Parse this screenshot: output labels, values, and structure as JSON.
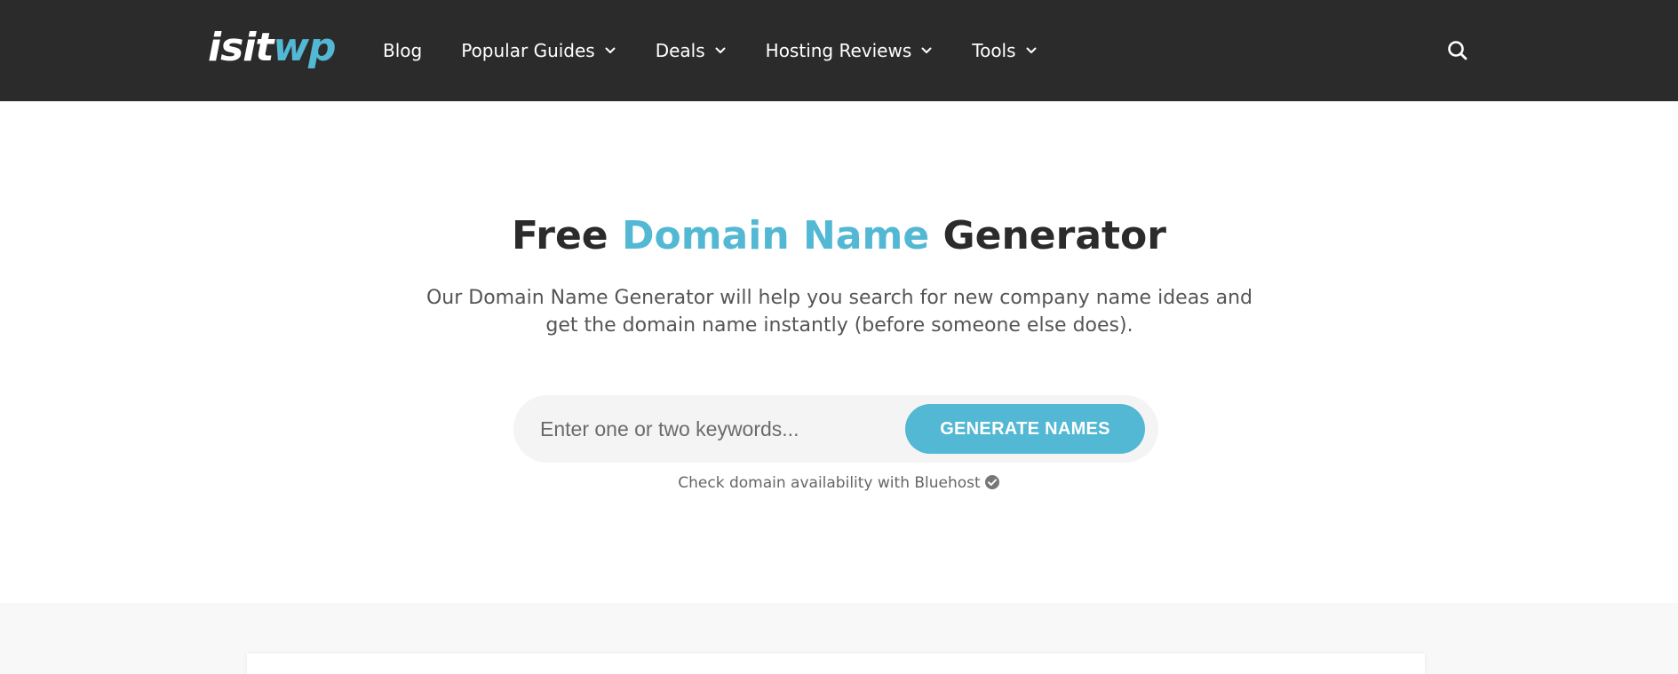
{
  "header": {
    "logo": {
      "part1": "isit",
      "part2": "wp"
    },
    "nav": [
      {
        "label": "Blog",
        "dropdown": false
      },
      {
        "label": "Popular Guides",
        "dropdown": true
      },
      {
        "label": "Deals",
        "dropdown": true
      },
      {
        "label": "Hosting Reviews",
        "dropdown": true
      },
      {
        "label": "Tools",
        "dropdown": true
      }
    ],
    "search_icon": "search-icon"
  },
  "hero": {
    "title_before": "Free ",
    "title_accent": "Domain Name",
    "title_after": " Generator",
    "subtitle": "Our Domain Name Generator will help you search for new company name ideas and get the domain name instantly (before someone else does).",
    "input": {
      "placeholder": "Enter one or two keywords...",
      "value": ""
    },
    "button_label": "GENERATE NAMES",
    "note": "Check domain availability with Bluehost",
    "note_icon": "check-circle-icon"
  },
  "colors": {
    "accent": "#52b8d3",
    "topbar": "#2b2b2b",
    "text": "#2b2b2b"
  }
}
